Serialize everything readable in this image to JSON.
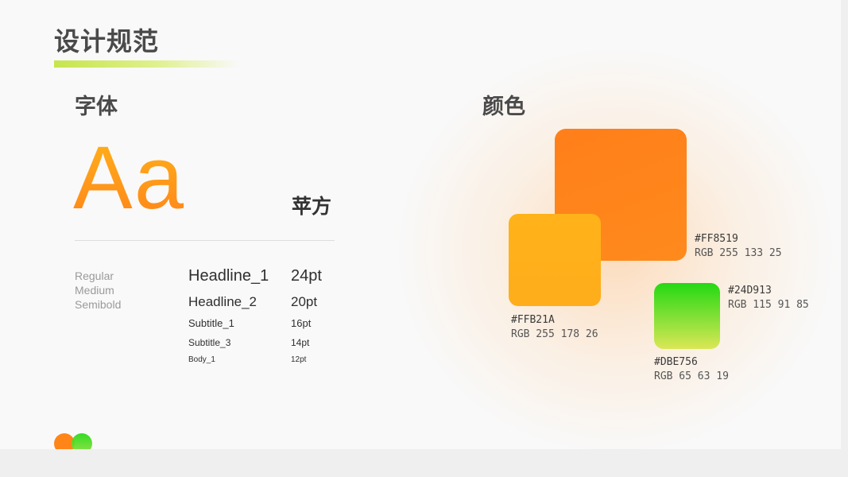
{
  "page": {
    "title": "设计规范"
  },
  "typography": {
    "heading": "字体",
    "sample": "Aa",
    "font_name": "苹方",
    "weights": [
      "Regular",
      "Medium",
      "Semibold"
    ],
    "styles": [
      {
        "name": "Headline_1",
        "size": "24pt"
      },
      {
        "name": "Headline_2",
        "size": "20pt"
      },
      {
        "name": "Subtitle_1",
        "size": "16pt"
      },
      {
        "name": "Subtitle_3",
        "size": "14pt"
      },
      {
        "name": "Body_1",
        "size": "12pt"
      }
    ]
  },
  "colors": {
    "heading": "颜色",
    "swatches": [
      {
        "hex": "#FF8519",
        "rgb": "RGB 255 133 25"
      },
      {
        "hex": "#FFB21A",
        "rgb": "RGB 255 178 26"
      },
      {
        "hex": "#24D913",
        "rgb": "RGB 115 91 85"
      },
      {
        "hex": "#DBE756",
        "rgb": "RGB 65 63 19"
      }
    ]
  },
  "palette": {
    "orange": "#FF8519",
    "yellow": "#FFB21A",
    "green": "#24D913",
    "lime": "#DBE756",
    "accent_bar": "#C6E54D"
  },
  "icons": {
    "logo": "two-circles-logo-icon"
  }
}
